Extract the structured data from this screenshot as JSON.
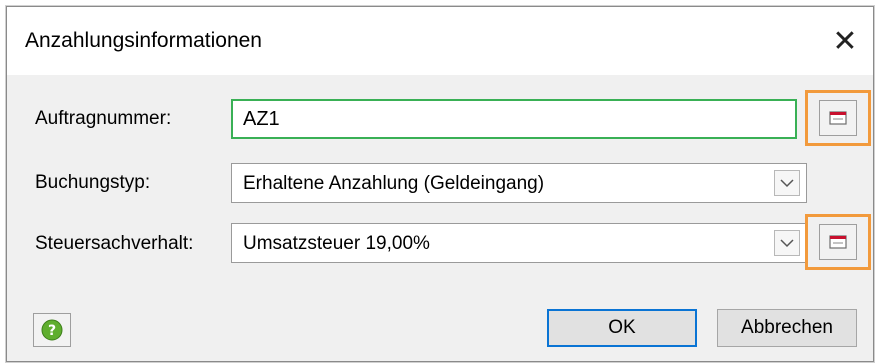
{
  "dialog": {
    "title": "Anzahlungsinformationen",
    "close_glyph": "✕"
  },
  "fields": {
    "auftragnummer": {
      "label": "Auftragnummer:",
      "value": "AZ1"
    },
    "buchungstyp": {
      "label": "Buchungstyp:",
      "value": "Erhaltene Anzahlung (Geldeingang)"
    },
    "steuersachverhalt": {
      "label": "Steuersachverhalt:",
      "value": "Umsatzsteuer 19,00%"
    }
  },
  "buttons": {
    "ok": "OK",
    "cancel": "Abbrechen"
  },
  "icons": {
    "help": "help-icon",
    "picker": "window-picker-icon",
    "dropdown": "chevron-down-icon"
  },
  "colors": {
    "highlight": "#f29a3c",
    "focus_border": "#39b055",
    "default_button_border": "#0a74d4"
  }
}
